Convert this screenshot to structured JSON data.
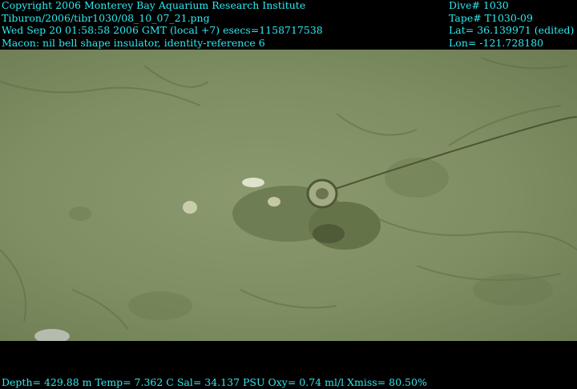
{
  "header_left": [
    "Copyright 2006 Monterey Bay Aquarium Research Institute",
    "Tiburon/2006/tibr1030/08_10_07_21.png",
    "Wed Sep 20 01:58:58 2006 GMT (local +7)  esecs=1158717538",
    "Macon: nil bell shape insulator, identity-reference 6"
  ],
  "header_right": [
    "Dive# 1030",
    "Tape# T1030-09",
    "Lat= 36.139971 (edited)",
    "Lon= -121.728180"
  ],
  "footer": "Depth= 429.88 m  Temp= 7.362 C  Sal= 34.137 PSU  Oxy= 0.74 ml/l  Xmiss= 80.50%",
  "colors": {
    "overlay_text": "#2fe8f0",
    "seafloor": "#82916a",
    "background": "#000000"
  }
}
